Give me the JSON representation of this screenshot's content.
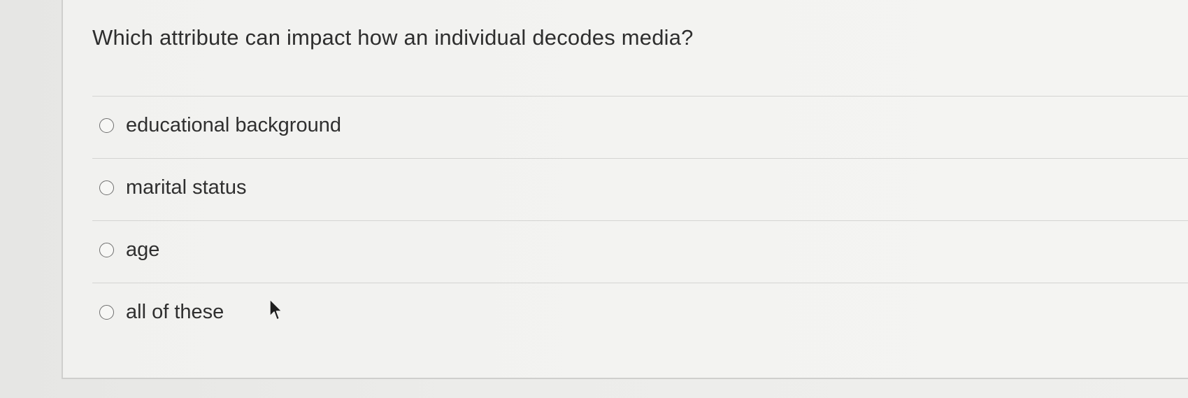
{
  "question": {
    "text": "Which attribute can impact how an individual decodes media?"
  },
  "options": [
    {
      "label": "educational background",
      "selected": false
    },
    {
      "label": "marital status",
      "selected": false
    },
    {
      "label": "age",
      "selected": false
    },
    {
      "label": "all of these",
      "selected": false
    }
  ]
}
